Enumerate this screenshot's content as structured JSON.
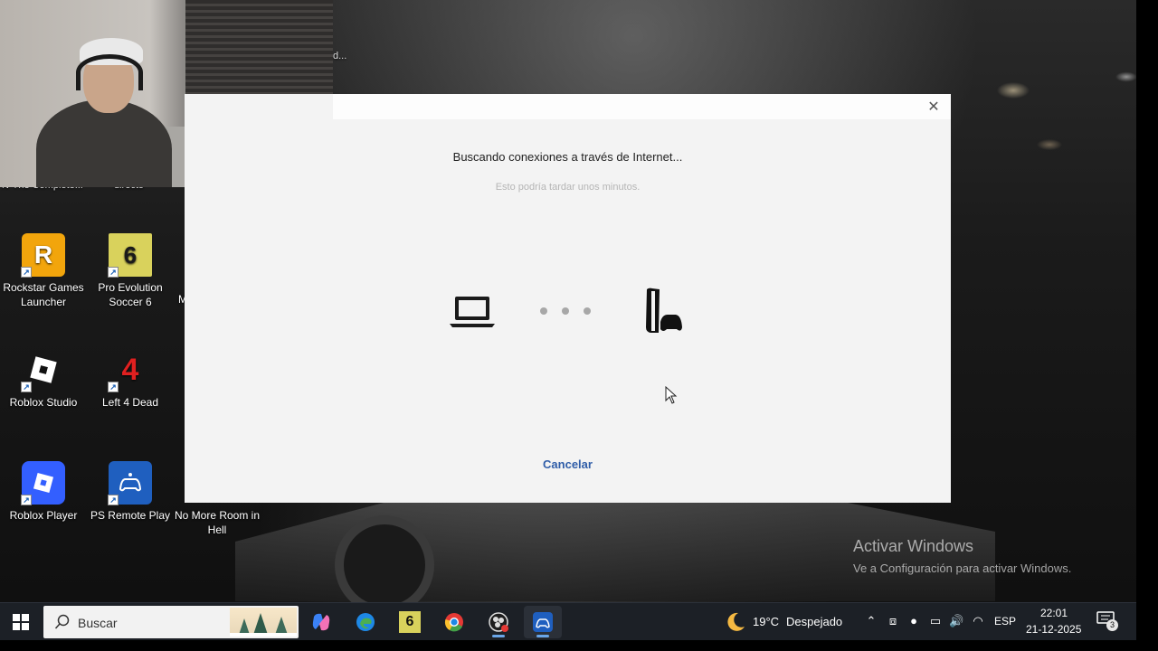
{
  "desktop_icons": [
    {
      "label": "Rockstar Games Launcher",
      "line1": "Rockstar Games",
      "line2": "Launcher",
      "icon": "rockstar-icon"
    },
    {
      "label": "Pro Evolution Soccer 6",
      "line1": "Pro Evolution",
      "line2": "Soccer 6",
      "icon": "pes6-icon"
    },
    {
      "label": "Roblox Studio",
      "line1": "Roblox Studio",
      "line2": "",
      "icon": "roblox-studio-icon"
    },
    {
      "label": "Left 4 Dead",
      "line1": "Left 4 Dead",
      "line2": "",
      "icon": "left4dead-icon"
    },
    {
      "label": "Roblox Player",
      "line1": "Roblox Player",
      "line2": "",
      "icon": "roblox-player-icon"
    },
    {
      "label": "PS Remote Play",
      "line1": "PS Remote Play",
      "line2": "",
      "icon": "ps-remote-play-icon"
    },
    {
      "label": "No More Room in Hell",
      "line1": "No More Room in",
      "line2": "Hell",
      "icon": "nmrih-icon"
    }
  ],
  "partial_labels": {
    "top_left_1": "N-The Complete...",
    "top_left_2": "directo",
    "webcam_edge": "d..."
  },
  "dialog": {
    "heading": "Buscando conexiones a través de Internet...",
    "subheading": "Esto podría tardar unos minutos.",
    "cancel_label": "Cancelar",
    "close_symbol": "✕"
  },
  "watermark": {
    "title": "Activar Windows",
    "subtitle": "Ve a Configuración para activar Windows."
  },
  "taskbar": {
    "search_placeholder": "Buscar",
    "apps": [
      "copilot-icon",
      "edge-icon",
      "pes6-icon",
      "chrome-icon",
      "obs-icon",
      "ps-remote-play-icon"
    ],
    "weather": {
      "temp": "19°C",
      "condition": "Despejado"
    },
    "language": "ESP",
    "time": "22:01",
    "date": "21-12-2025",
    "notifications": "3"
  }
}
